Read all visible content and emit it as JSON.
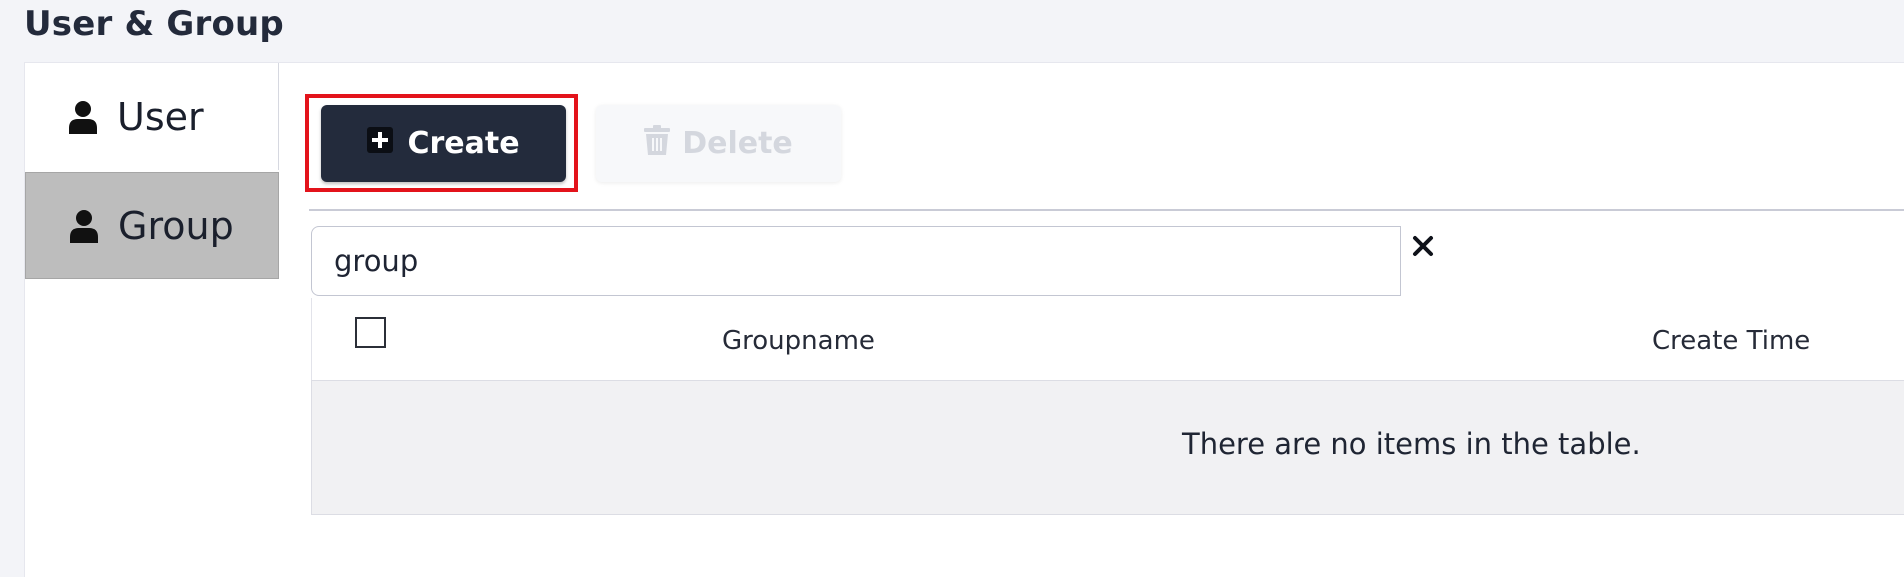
{
  "page": {
    "title": "User & Group"
  },
  "sidebar": {
    "items": [
      {
        "label": "User",
        "icon": "user-icon",
        "active": false
      },
      {
        "label": "Group",
        "icon": "user-icon",
        "active": true
      }
    ]
  },
  "toolbar": {
    "create_label": "Create",
    "create_icon": "plus-square-icon",
    "delete_label": "Delete",
    "delete_icon": "trash-icon",
    "delete_disabled": true,
    "highlight_color": "#e3131b"
  },
  "search": {
    "value": "group",
    "clear_icon": "close-icon"
  },
  "table": {
    "columns": [
      "Groupname",
      "Create Time"
    ],
    "empty_message": "There are no items in the table.",
    "rows": []
  },
  "colors": {
    "primary_button": "#232b3c",
    "active_tab": "#bdbdbd",
    "background": "#f3f4f8"
  }
}
